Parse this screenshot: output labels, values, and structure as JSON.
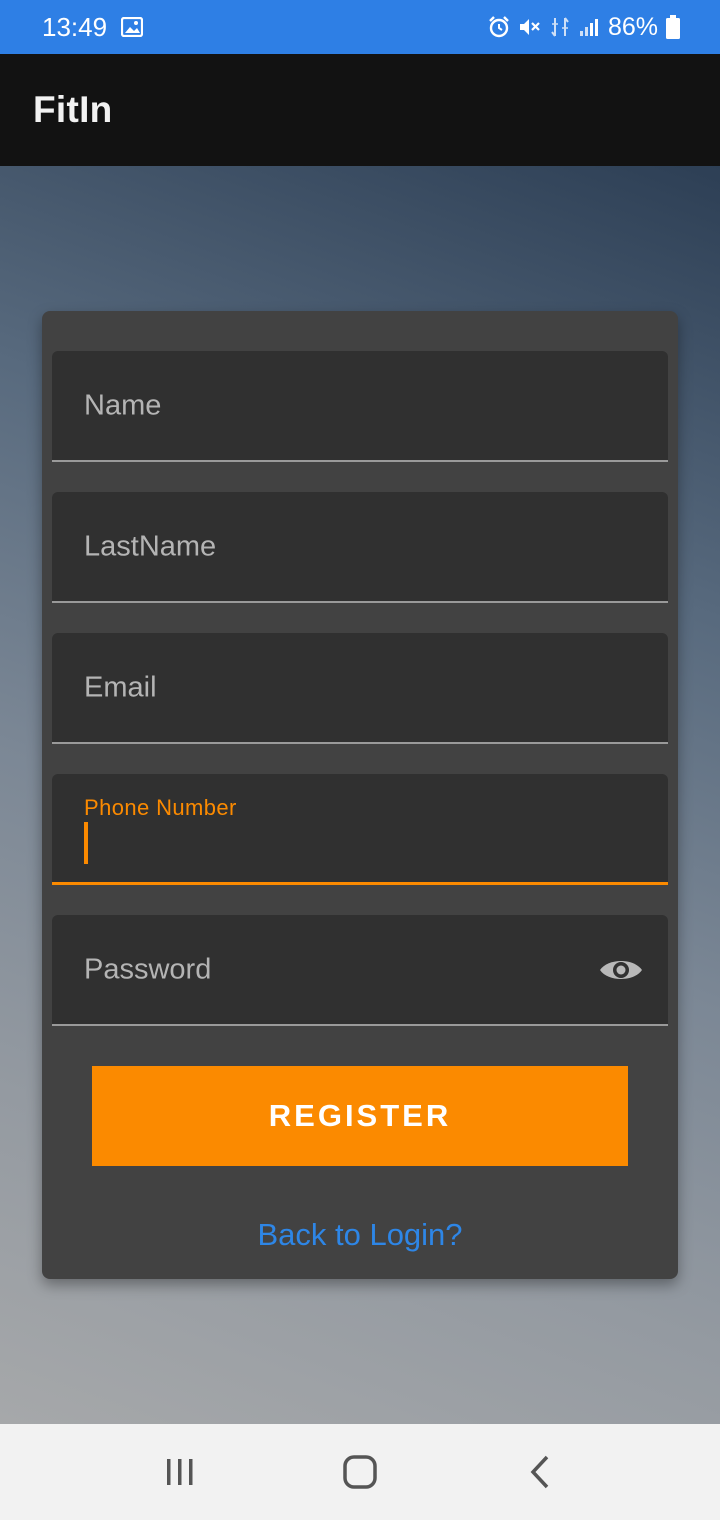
{
  "status_bar": {
    "time": "13:49",
    "battery": "86%",
    "icons": [
      "image-icon",
      "alarm-icon",
      "mute-icon",
      "data-icon",
      "signal-icon",
      "battery-icon"
    ]
  },
  "app_bar": {
    "title": "FitIn"
  },
  "form": {
    "name_label": "Name",
    "lastname_label": "LastName",
    "email_label": "Email",
    "phone_label": "Phone Number",
    "phone_value": "",
    "password_label": "Password",
    "register_label": "REGISTER",
    "back_link": "Back to Login?"
  },
  "colors": {
    "accent": "#fb8a00",
    "status_bar": "#2e7fe5",
    "link": "#2e86e6",
    "card": "#424242",
    "field": "#303030"
  },
  "nav_bar": {
    "icons": [
      "recents-icon",
      "home-icon",
      "back-icon"
    ]
  }
}
